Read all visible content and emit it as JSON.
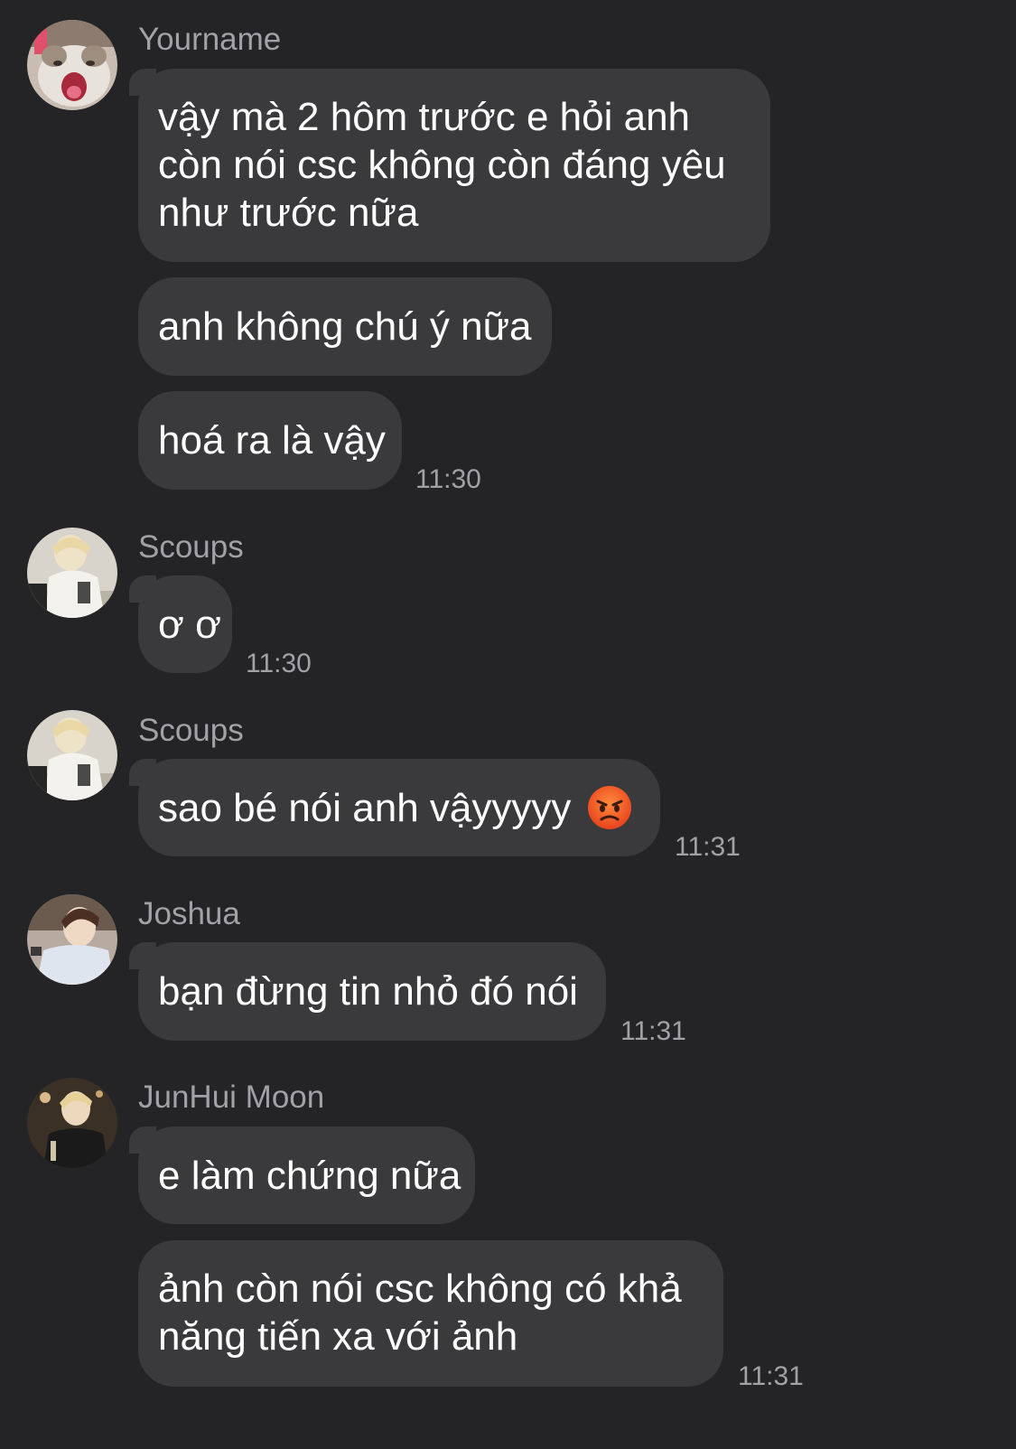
{
  "messages": [
    {
      "sender": "Yourname",
      "avatar_icon": "cat-avatar",
      "bubbles": [
        "vậy mà 2 hôm trước e hỏi anh còn nói csc không còn đáng yêu như trước nữa",
        "anh không chú ý nữa",
        "hoá ra là vậy"
      ],
      "time": "11:30"
    },
    {
      "sender": "Scoups",
      "avatar_icon": "person-white-jacket-avatar",
      "bubbles": [
        "ơ ơ"
      ],
      "time": "11:30"
    },
    {
      "sender": "Scoups",
      "avatar_icon": "person-white-jacket-avatar",
      "bubbles": [
        "sao bé nói anh vậyyyyy"
      ],
      "emoji": "angry-face-emoji",
      "time": "11:31"
    },
    {
      "sender": "Joshua",
      "avatar_icon": "person-light-shirt-avatar",
      "bubbles": [
        "bạn đừng tin nhỏ đó nói"
      ],
      "time": "11:31"
    },
    {
      "sender": "JunHui Moon",
      "avatar_icon": "person-dark-outfit-avatar",
      "bubbles": [
        "e làm chứng nữa",
        "ảnh còn nói csc không có khả năng tiến xa với ảnh"
      ],
      "time": "11:31"
    }
  ],
  "colors": {
    "background": "#242426",
    "bubble": "#3a3a3c",
    "text": "#ffffff",
    "meta": "#a1a1a6"
  }
}
